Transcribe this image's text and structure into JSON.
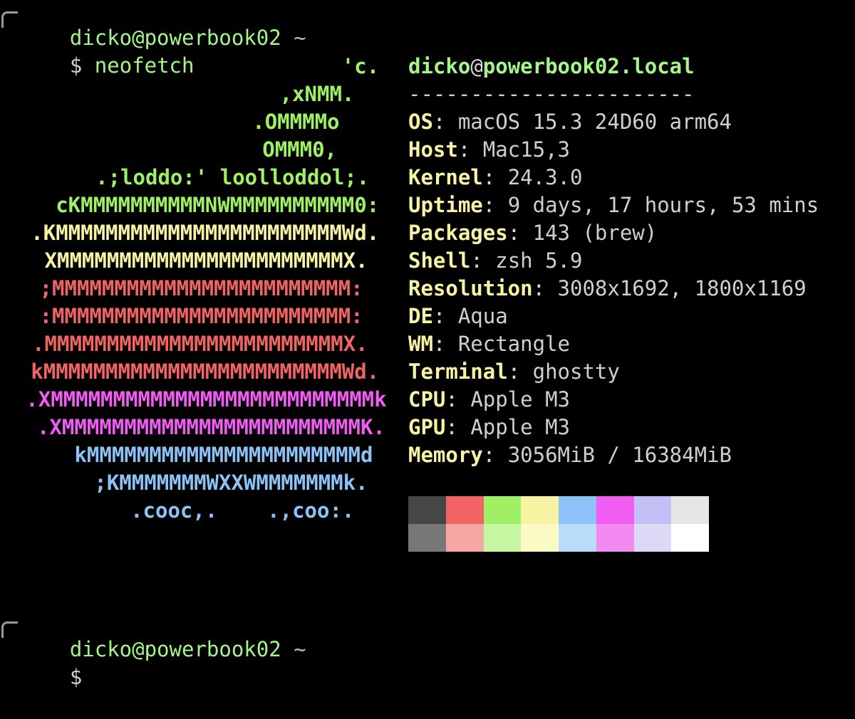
{
  "prompt1": {
    "user_host": "dicko@powerbook02",
    "path": "~",
    "dollar": "$",
    "command": "neofetch"
  },
  "art": [
    {
      "text": "'c.",
      "color": "green",
      "indent": 7
    },
    {
      "text": ",xNMM.",
      "color": "green",
      "indent": 9
    },
    {
      "text": ".OMMMMo",
      "color": "green",
      "indent": 10
    },
    {
      "text": "OMMM0,",
      "color": "green",
      "indent": 11
    },
    {
      "text": ".;loddo:' loolloddol;.",
      "color": "green",
      "indent": 5
    },
    {
      "text": "cKMMMMMMMMMMNWMMMMMMMMMM0:",
      "color": "green",
      "indent": 3
    },
    {
      "text": ".KMMMMMMMMMMMMMMMMMMMMMMMWd.",
      "color": "yellow",
      "indent": 3
    },
    {
      "text": "XMMMMMMMMMMMMMMMMMMMMMMMX.",
      "color": "yellow",
      "indent": 5
    },
    {
      "text": ";MMMMMMMMMMMMMMMMMMMMMMMM:",
      "color": "red",
      "indent": 6
    },
    {
      "text": ":MMMMMMMMMMMMMMMMMMMMMMMM:",
      "color": "red",
      "indent": 6
    },
    {
      "text": ".MMMMMMMMMMMMMMMMMMMMMMMMX.",
      "color": "red",
      "indent": 5
    },
    {
      "text": "kMMMMMMMMMMMMMMMMMMMMMMMMWd.",
      "color": "red",
      "indent": 3
    },
    {
      "text": ".XMMMMMMMMMMMMMMMMMMMMMMMMMMk",
      "color": "magenta",
      "indent": 2
    },
    {
      "text": ".XMMMMMMMMMMMMMMMMMMMMMMMMK.",
      "color": "magenta",
      "indent": 2
    },
    {
      "text": "kMMMMMMMMMMMMMMMMMMMMMMd",
      "color": "blue",
      "indent": 4
    },
    {
      "text": ";KMMMMMMMWXXWMMMMMMMk.",
      "color": "blue",
      "indent": 5
    },
    {
      "text": ".cooc,.    .,coo:.",
      "color": "blue",
      "indent": 7
    }
  ],
  "info": {
    "user": "dicko",
    "at": "@",
    "host": "powerbook02.local",
    "separator": "-----------------------",
    "fields": [
      {
        "key": "OS",
        "value": "macOS 15.3 24D60 arm64"
      },
      {
        "key": "Host",
        "value": "Mac15,3"
      },
      {
        "key": "Kernel",
        "value": "24.3.0"
      },
      {
        "key": "Uptime",
        "value": "9 days, 17 hours, 53 mins"
      },
      {
        "key": "Packages",
        "value": "143 (brew)"
      },
      {
        "key": "Shell",
        "value": "zsh 5.9"
      },
      {
        "key": "Resolution",
        "value": "3008x1692, 1800x1169"
      },
      {
        "key": "DE",
        "value": "Aqua"
      },
      {
        "key": "WM",
        "value": "Rectangle"
      },
      {
        "key": "Terminal",
        "value": "ghostty"
      },
      {
        "key": "CPU",
        "value": "Apple M3"
      },
      {
        "key": "GPU",
        "value": "Apple M3"
      },
      {
        "key": "Memory",
        "value": "3056MiB / 16384MiB"
      }
    ]
  },
  "palette": {
    "normal": [
      "#464646",
      "#f26363",
      "#9ff064",
      "#f7f3a4",
      "#8cc2f5",
      "#f05df0",
      "#c4c0f7",
      "#e6e6e6"
    ],
    "bright": [
      "#777777",
      "#f7a6a6",
      "#c8f7a4",
      "#fafac5",
      "#b8dcfa",
      "#f28af2",
      "#dcd9f7",
      "#ffffff"
    ]
  },
  "prompt2": {
    "user_host": "dicko@powerbook02",
    "path": "~",
    "dollar": "$"
  }
}
